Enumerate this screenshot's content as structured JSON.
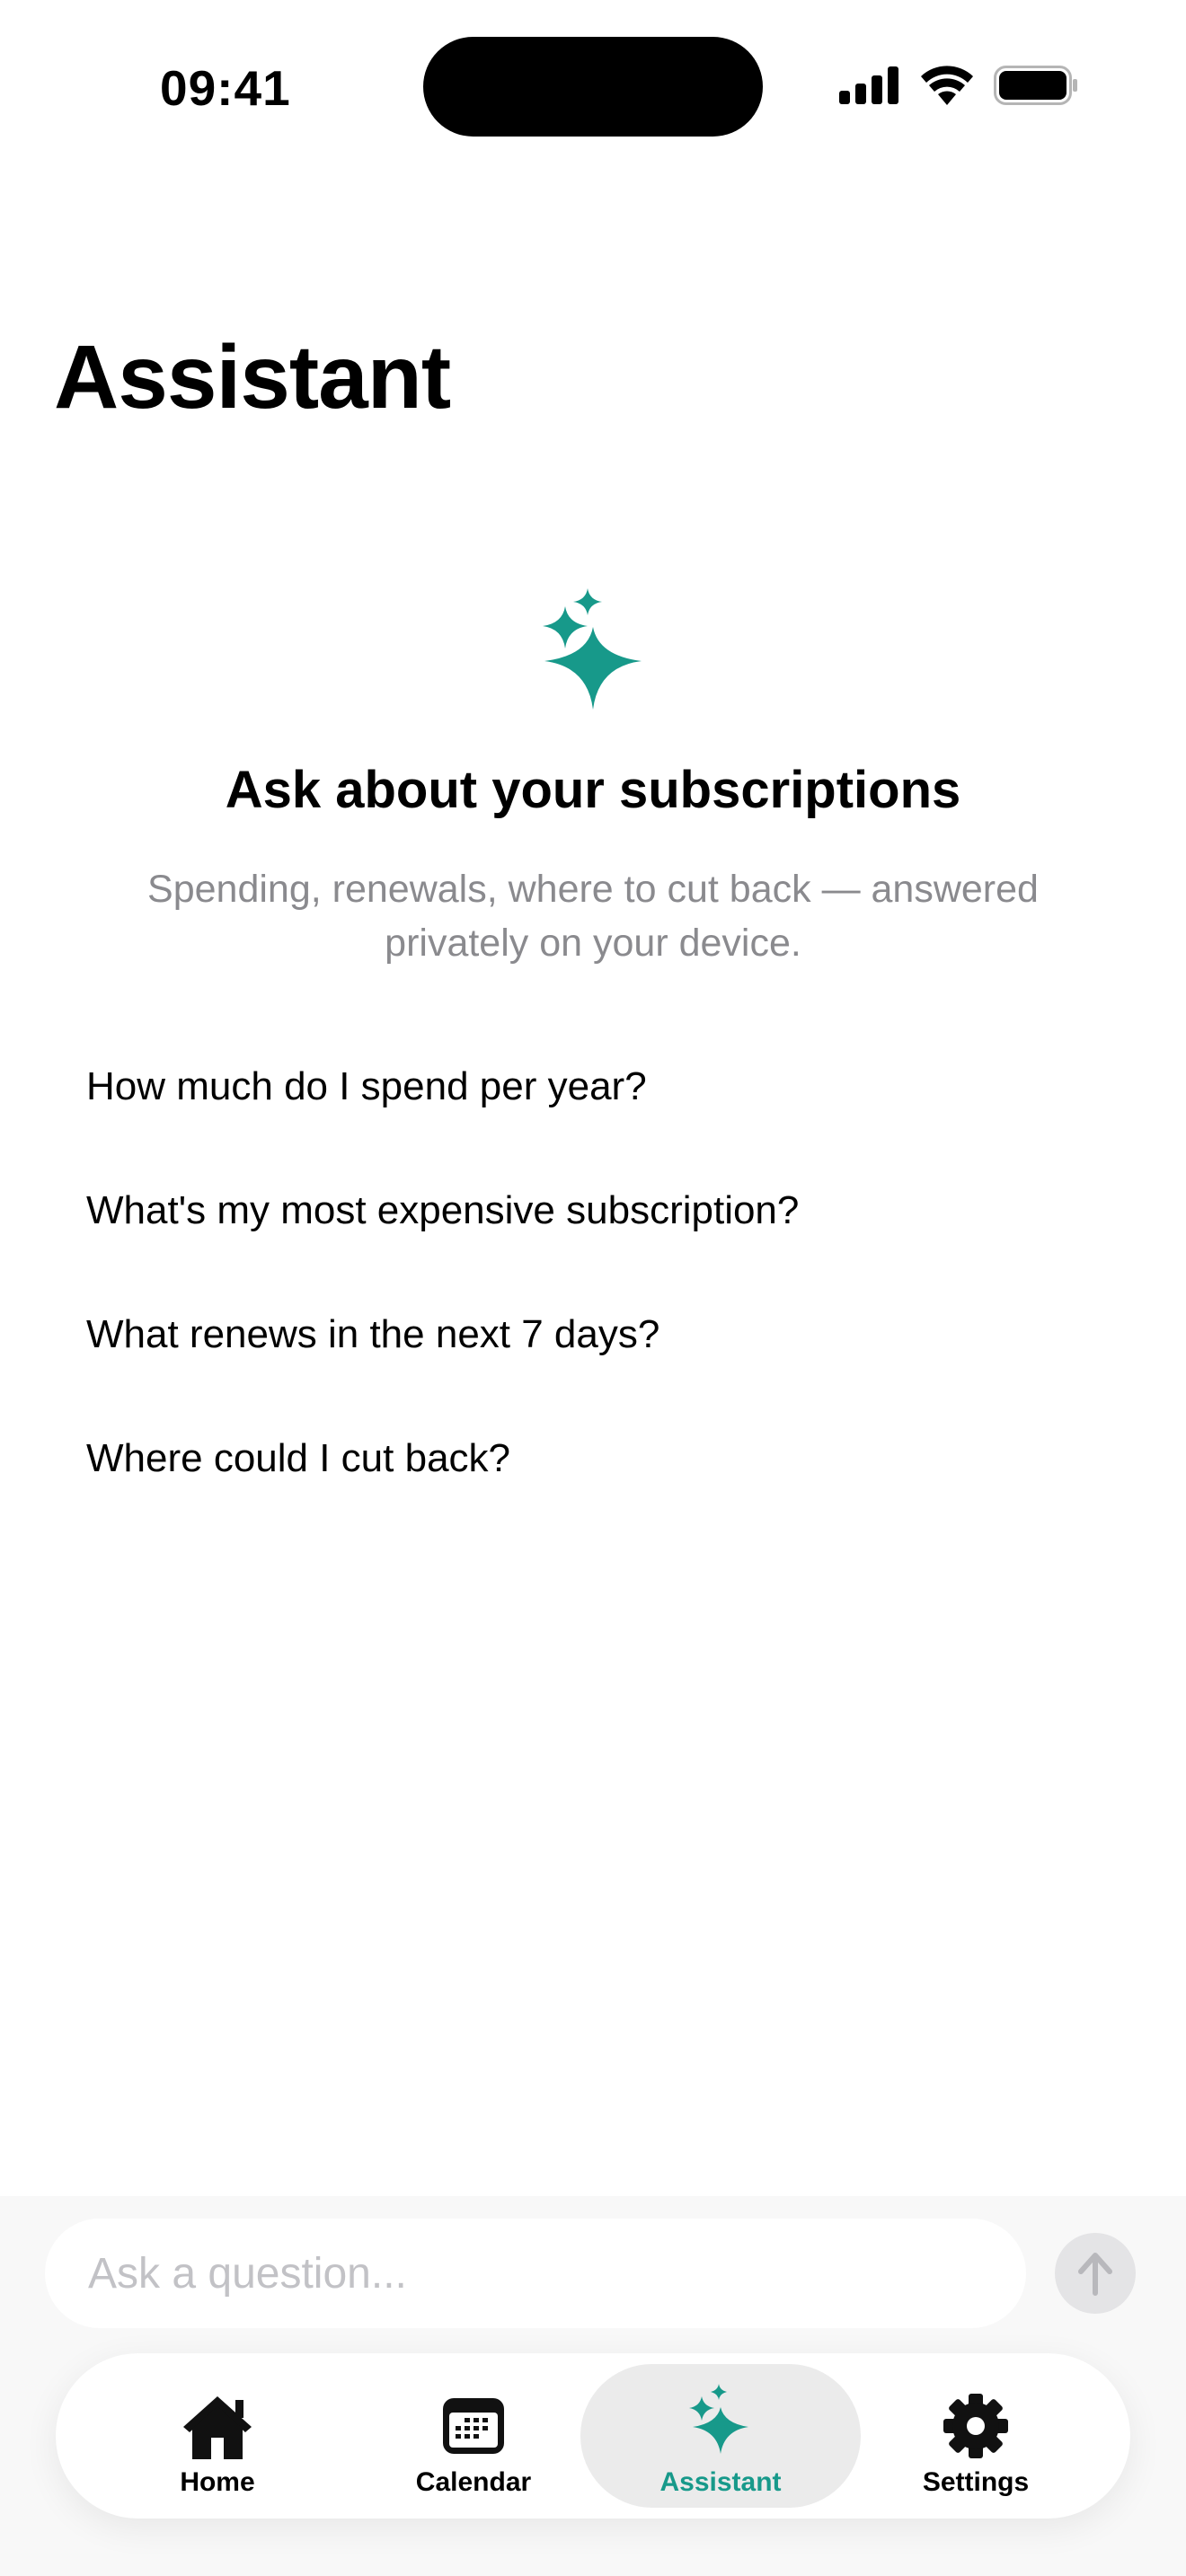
{
  "status_bar": {
    "time": "09:41",
    "icons": [
      "signal-icon",
      "wifi-icon",
      "battery-icon"
    ]
  },
  "header": {
    "title": "Assistant"
  },
  "empty_state": {
    "icon": "sparkles-icon",
    "title": "Ask about your subscriptions",
    "subtitle": "Spending, renewals, where to cut back — answered privately on your device."
  },
  "suggestions": [
    "How much do I spend per year?",
    "What's my most expensive subscription?",
    "What renews in the next 7 days?",
    "Where could I cut back?"
  ],
  "composer": {
    "placeholder": "Ask a question...",
    "send_icon": "arrow-up-icon"
  },
  "tab_bar": {
    "active": "Assistant",
    "tabs": [
      {
        "label": "Home",
        "icon": "home-icon"
      },
      {
        "label": "Calendar",
        "icon": "calendar-icon"
      },
      {
        "label": "Assistant",
        "icon": "sparkles-icon"
      },
      {
        "label": "Settings",
        "icon": "gear-icon"
      }
    ]
  },
  "colors": {
    "accent": "#17998A",
    "text_primary": "#000000",
    "text_secondary": "#8A8A8E",
    "placeholder": "#C2C2C6",
    "active_tab_bg": "#EBEBEB",
    "bottom_bg": "#F8F8F8"
  }
}
